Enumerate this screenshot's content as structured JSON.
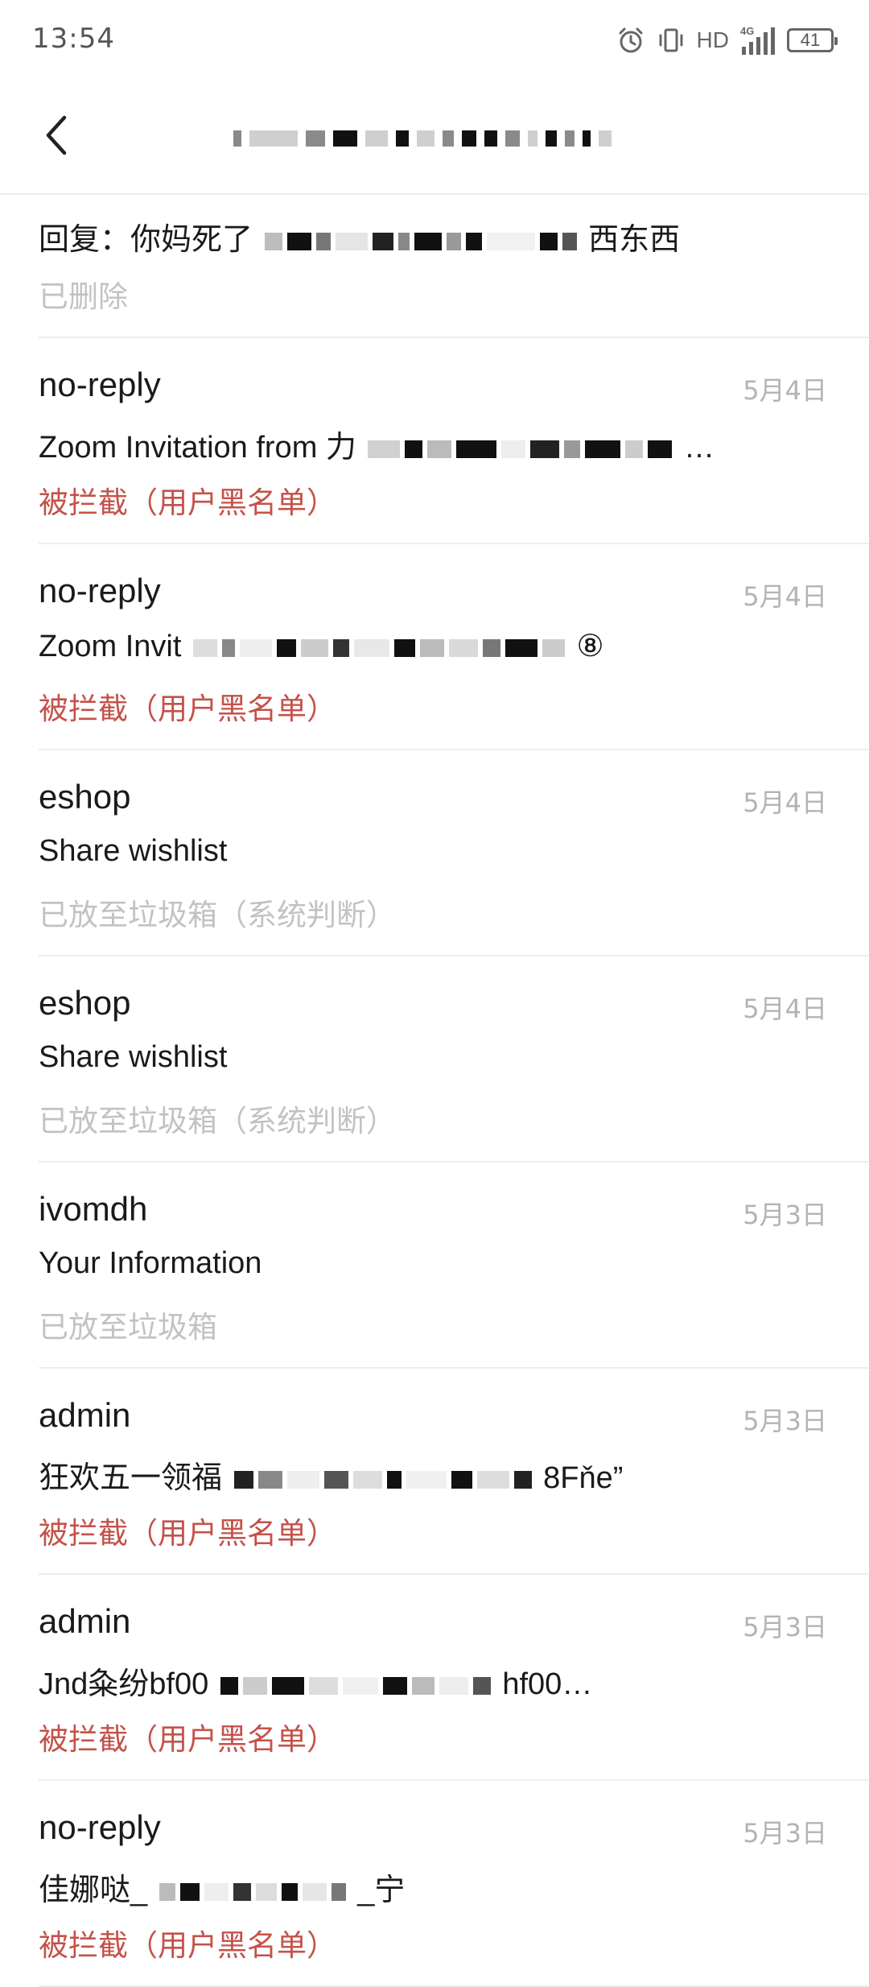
{
  "status_bar": {
    "time": "13:54",
    "network": "HD",
    "signal_label": "4G",
    "battery": "41"
  },
  "header": {
    "back_icon": "chevron-left-icon"
  },
  "mails": [
    {
      "sender": "",
      "date": "",
      "subject_pre": "回复：你妈死了",
      "subject_post": "西东西",
      "status": "已删除",
      "status_type": "gray"
    },
    {
      "sender": "no-reply",
      "date": "5月4日",
      "subject_pre": "Zoom Invitation from 力",
      "subject_post": "…",
      "status": "被拦截（用户黑名单）",
      "status_type": "blocked"
    },
    {
      "sender": "no-reply",
      "date": "5月4日",
      "subject_pre": "Zoom Invit",
      "subject_post": "⑧",
      "status": "被拦截（用户黑名单）",
      "status_type": "blocked"
    },
    {
      "sender": "eshop",
      "date": "5月4日",
      "subject_pre": "Share wishlist",
      "subject_post": "",
      "status": "已放至垃圾箱（系统判断）",
      "status_type": "gray"
    },
    {
      "sender": "eshop",
      "date": "5月4日",
      "subject_pre": "Share wishlist",
      "subject_post": "",
      "status": "已放至垃圾箱（系统判断）",
      "status_type": "gray"
    },
    {
      "sender": "ivomdh",
      "date": "5月3日",
      "subject_pre": "Your Information",
      "subject_post": "",
      "status": "已放至垃圾箱",
      "status_type": "gray"
    },
    {
      "sender": "admin",
      "date": "5月3日",
      "subject_pre": "狂欢五一领福",
      "subject_post": "8Fňe”",
      "status": "被拦截（用户黑名单）",
      "status_type": "blocked"
    },
    {
      "sender": "admin",
      "date": "5月3日",
      "subject_pre": "Jnd粂纷bf00",
      "subject_post": "hf00…",
      "status": "被拦截（用户黑名单）",
      "status_type": "blocked"
    },
    {
      "sender": "no-reply",
      "date": "5月3日",
      "subject_pre": "佳娜哒_",
      "subject_post": "_宁",
      "status": "被拦截（用户黑名单）",
      "status_type": "blocked"
    }
  ],
  "colors": {
    "blocked": "#c4524a",
    "muted": "#c2c2c2",
    "divider": "#ededed"
  }
}
